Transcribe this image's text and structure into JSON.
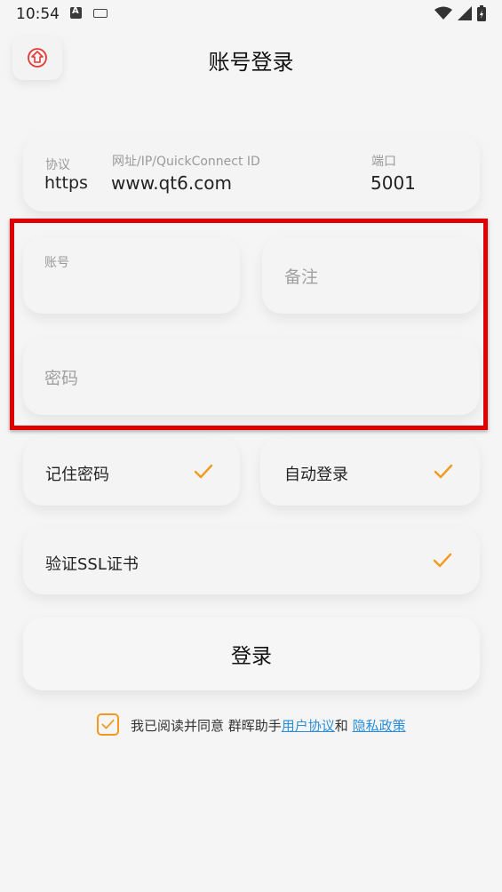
{
  "status_bar": {
    "time": "10:54",
    "notification_letter": "A"
  },
  "header": {
    "title": "账号登录"
  },
  "server": {
    "protocol_label": "协议",
    "protocol_value": "https",
    "address_label": "网址/IP/QuickConnect ID",
    "address_value": "www.qt6.com",
    "port_label": "端口",
    "port_value": "5001"
  },
  "account": {
    "label": "账号",
    "value": ""
  },
  "remark": {
    "placeholder": "备注"
  },
  "password": {
    "placeholder": "密码"
  },
  "options": {
    "remember": "记住密码",
    "auto_login": "自动登录",
    "verify_ssl": "验证SSL证书"
  },
  "login_button": "登录",
  "agreement": {
    "prefix": "我已阅读并同意 群晖助手",
    "user_agreement": "用户协议",
    "conj": "和 ",
    "privacy": "隐私政策"
  },
  "colors": {
    "accent": "#f39a1e",
    "link": "#2b8ed8",
    "highlight": "#e00000",
    "back_icon": "#e53935"
  }
}
